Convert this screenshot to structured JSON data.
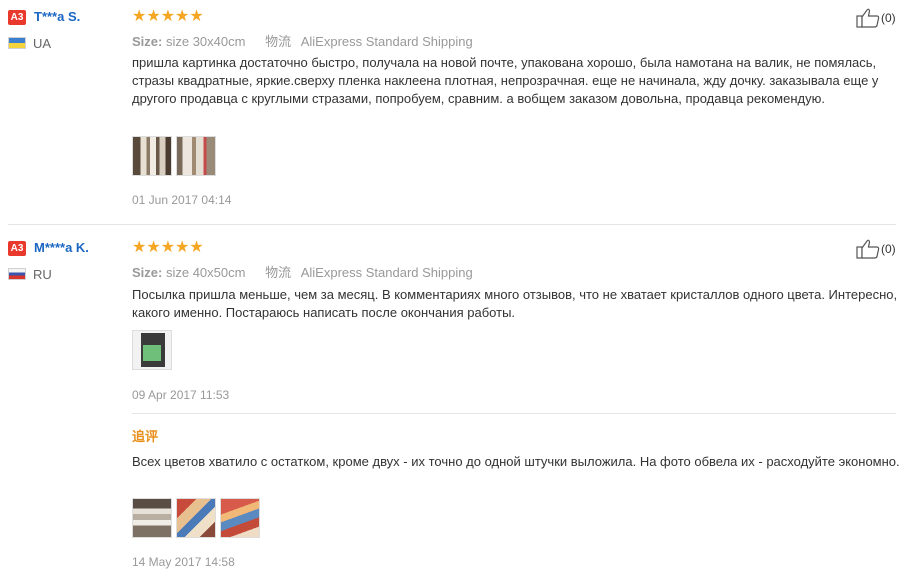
{
  "reviews": [
    {
      "badge": "A3",
      "name": "T***a S.",
      "country": "UA",
      "stars": "★★★★★",
      "size_label": "Size:",
      "size_value": "size 30x40cm",
      "shipping_mark": "物流",
      "shipping": "AliExpress Standard Shipping",
      "likes": "(0)",
      "text": "пришла картинка достаточно быстро, получала на новой почте, упакована хорошо, была намотана на валик, не помялась, стразы квадратные, яркие.сверху пленка наклеена плотная, непрозрачная. еще не начинала, жду дочку. заказывала еще у другого продавца с круглыми стразами, попробуем, сравним. а вобщем заказом довольна, продавца рекомендую.",
      "date": "01 Jun 2017 04:14"
    },
    {
      "badge": "A3",
      "name": "M****a K.",
      "country": "RU",
      "stars": "★★★★★",
      "size_label": "Size:",
      "size_value": "size 40x50cm",
      "shipping_mark": "物流",
      "shipping": "AliExpress Standard Shipping",
      "likes": "(0)",
      "text": "Посылка пришла меньше, чем за месяц. В комментариях много отзывов, что не хватает кристаллов одного цвета. Интересно, какого именно. Постараюсь написать после окончания работы.",
      "date": "09 Apr 2017 11:53",
      "followup": {
        "label": "追评",
        "text": "Всех цветов хватило с остатком, кроме двух - их точно до одной штучки выложила. На фото обвела их - расходуйте экономно.",
        "date": "14 May 2017 14:58"
      }
    }
  ],
  "colors": {
    "badge": "#e8392c",
    "name": "#1a66c2",
    "star": "#f5a623",
    "followup": "#e8901a",
    "ua_top": "#3b7fd0",
    "ua_bottom": "#f4d43a"
  }
}
